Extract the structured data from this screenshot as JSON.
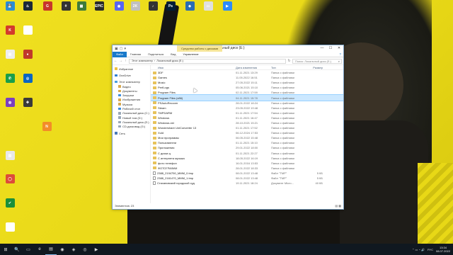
{
  "desktop": {
    "icons": [
      {
        "label": "",
        "color": "#2b8dd6",
        "glyph": "💾"
      },
      {
        "label": "",
        "color": "#1b2838",
        "glyph": "♨"
      },
      {
        "label": "",
        "color": "#c7352b",
        "glyph": "G"
      },
      {
        "label": "",
        "color": "#333333",
        "glyph": "#"
      },
      {
        "label": "",
        "color": "#3f7a3a",
        "glyph": "▦"
      },
      {
        "label": "",
        "color": "#2a2a2a",
        "glyph": "EPIC"
      },
      {
        "label": "",
        "color": "#5865f2",
        "glyph": "◉"
      },
      {
        "label": "",
        "color": "#c0c0c0",
        "glyph": "2K"
      },
      {
        "label": "",
        "color": "#333333",
        "glyph": "♪"
      },
      {
        "label": "",
        "color": "#001e36",
        "glyph": "Ps"
      },
      {
        "label": "",
        "color": "#2a6db5",
        "glyph": "◆"
      },
      {
        "label": "",
        "color": "#e0e0e0",
        "glyph": "▭"
      },
      {
        "label": "",
        "color": "#2d8cff",
        "glyph": "▶"
      },
      {
        "label": "",
        "color": "#d33a2c",
        "glyph": "K"
      },
      {
        "label": "",
        "color": "#ffffff",
        "glyph": "▮"
      },
      {
        "label": "",
        "color": "#eeeeee",
        "glyph": "▤"
      },
      {
        "label": "",
        "color": "#c0392b",
        "glyph": "●"
      },
      {
        "label": "",
        "color": "#1a9e4a",
        "glyph": "✆"
      },
      {
        "label": "",
        "color": "#0a66c2",
        "glyph": "◎"
      },
      {
        "label": "",
        "color": "#7b3fc0",
        "glyph": "◍"
      },
      {
        "label": "",
        "color": "#3a3a3a",
        "glyph": "✚"
      },
      {
        "label": "",
        "color": "#f28c28",
        "glyph": "N"
      },
      {
        "label": "",
        "color": "#e8e8e8",
        "glyph": "▥"
      },
      {
        "label": "",
        "color": "#dd4b39",
        "glyph": "◯"
      },
      {
        "label": "",
        "color": "#1b8f3a",
        "glyph": "✔"
      },
      {
        "label": "",
        "color": "#ffffff",
        "glyph": "▢"
      }
    ]
  },
  "window": {
    "qa_icons": [
      "▣",
      "▢",
      "▾"
    ],
    "tools_tab": "Средства работы с дисками",
    "title": "Локальный диск (E:)",
    "controls": {
      "minimize": "—",
      "maximize": "☐",
      "close": "✕"
    },
    "ribbon": {
      "file": "Файл",
      "tabs": [
        "Главная",
        "Поделиться",
        "Вид",
        "Управление"
      ],
      "help": "?"
    },
    "address": {
      "back": "←",
      "forward": "→",
      "up": "↑",
      "path": [
        "Этот компьютер",
        "›",
        "Локальный диск (E:)"
      ],
      "refresh": "↻",
      "search_placeholder": "Поиск: Локальный диск (E:)",
      "search_icon": "⌕"
    },
    "nav": [
      {
        "label": "Избранное",
        "color": "#f0c040",
        "gap": false
      },
      {
        "label": "OneDrive",
        "color": "#2e7fd6",
        "gap": true
      },
      {
        "label": "Этот компьютер",
        "color": "#4a9ee0",
        "gap": true
      },
      {
        "label": "Видео",
        "color": "#d8a850",
        "gap": false
      },
      {
        "label": "Документы",
        "color": "#d8a850",
        "gap": false
      },
      {
        "label": "Загрузки",
        "color": "#3a8de0",
        "gap": false
      },
      {
        "label": "Изображения",
        "color": "#d8a850",
        "gap": false
      },
      {
        "label": "Музыка",
        "color": "#d8a850",
        "gap": false
      },
      {
        "label": "Рабочий стол",
        "color": "#3a8de0",
        "gap": false
      },
      {
        "label": "Локальный диск (C:)",
        "color": "#9aa8b8",
        "gap": false
      },
      {
        "label": "Новый том (D:)",
        "color": "#9aa8b8",
        "gap": false
      },
      {
        "label": "Локальный диск (E:)",
        "color": "#9aa8b8",
        "gap": false
      },
      {
        "label": "CD-дисковод (G:)",
        "color": "#9aa8b8",
        "gap": false
      },
      {
        "label": "Сеть",
        "color": "#4a7ab8",
        "gap": true
      }
    ],
    "columns": {
      "name": "Имя",
      "date": "Дата изменения",
      "type": "Тип",
      "size": "Размер"
    },
    "files": [
      {
        "name": "3DF",
        "date": "01.11.2021 13:29",
        "type": "Папка с файлами",
        "size": "",
        "kind": "folder"
      },
      {
        "name": "Games",
        "date": "11.05.2022 16:51",
        "type": "Папка с файлами",
        "size": "",
        "kind": "folder"
      },
      {
        "name": "Music",
        "date": "27.05.2022 15:11",
        "type": "Папка с файлами",
        "size": "",
        "kind": "folder"
      },
      {
        "name": "PerfLogs",
        "date": "05.06.2021 15:10",
        "type": "Папка с файлами",
        "size": "",
        "kind": "folder"
      },
      {
        "name": "Program Files",
        "date": "02.11.2021 17:59",
        "type": "Папка с файлами",
        "size": "",
        "kind": "folder"
      },
      {
        "name": "Program Files (x86)",
        "date": "04.11.2021 15:78",
        "type": "Папка с файлами",
        "size": "",
        "kind": "folder"
      },
      {
        "name": "PSAutoRecover",
        "date": "28.01.2022 18:24",
        "type": "Папка с файлами",
        "size": "",
        "kind": "folder"
      },
      {
        "name": "Steam",
        "date": "23.05.2022 19:48",
        "type": "Папка с файлами",
        "size": "",
        "kind": "folder"
      },
      {
        "name": "TMPDARM",
        "date": "01.11.2021 17:54",
        "type": "Папка с файлами",
        "size": "",
        "kind": "folder"
      },
      {
        "name": "Windows",
        "date": "01.11.2021 16:47",
        "type": "Папка с файлами",
        "size": "",
        "kind": "folder"
      },
      {
        "name": "Windows.old",
        "date": "28.10.2021 15:21",
        "type": "Папка с файлами",
        "size": "",
        "kind": "folder"
      },
      {
        "name": "Wondershare UniConverter 13",
        "date": "01.11.2021 17:52",
        "type": "Папка с файлами",
        "size": "",
        "kind": "folder"
      },
      {
        "name": "Xuld",
        "date": "06.12.2024 17:53",
        "type": "Папка с файлами",
        "size": "",
        "kind": "folder"
      },
      {
        "name": "Мои программы",
        "date": "06.05.2022 15:48",
        "type": "Папка с файлами",
        "size": "",
        "kind": "folder"
      },
      {
        "name": "Пользователи",
        "date": "01.11.2021 15:10",
        "type": "Папка с файлами",
        "size": "",
        "kind": "folder"
      },
      {
        "name": "Приложения",
        "date": "29.01.2022 18:00",
        "type": "Папка с файлами",
        "size": "",
        "kind": "folder"
      },
      {
        "name": "С диска ц",
        "date": "01.11.2021 22:27",
        "type": "Папка с файлами",
        "size": "",
        "kind": "folder"
      },
      {
        "name": "С интернета музыка",
        "date": "18.05.2022 16:19",
        "type": "Папка с файлами",
        "size": "",
        "kind": "folder"
      },
      {
        "name": "фото телефон",
        "date": "16.01.2016 13:53",
        "type": "Папка с файлами",
        "size": "",
        "kind": "folder"
      },
      {
        "name": "ФОТОГРАФИИ",
        "date": "28.01.2022 18:33",
        "type": "Папка с файлами",
        "size": "",
        "kind": "folder"
      },
      {
        "name": "2388_2194750_MMM_0.tmp",
        "date": "08.01.2022 13:48",
        "type": "Файл \"TMP\"",
        "size": "5 КБ",
        "kind": "doc"
      },
      {
        "name": "2388_2161470_MMM_1.tmp",
        "date": "08.01.2022 13:48",
        "type": "Файл \"TMP\"",
        "size": "5 КБ",
        "kind": "doc"
      },
      {
        "name": "Стахановский городской суд",
        "date": "19.11.2021 18:24",
        "type": "Документ Micro...",
        "size": "40 КБ",
        "kind": "doc"
      }
    ],
    "status": "Элементов: 23",
    "view_icons": [
      "▤",
      "▦"
    ]
  },
  "taskbar": {
    "start": "⊞",
    "items": [
      "🔍",
      "▭",
      "e",
      "▤",
      "◉",
      "◈",
      "◎",
      "▶"
    ],
    "tray": {
      "icons": "⌃  ▭  ◔  🔊",
      "lang": "РУС",
      "time": "13:34",
      "date": "08.07.2022"
    }
  }
}
